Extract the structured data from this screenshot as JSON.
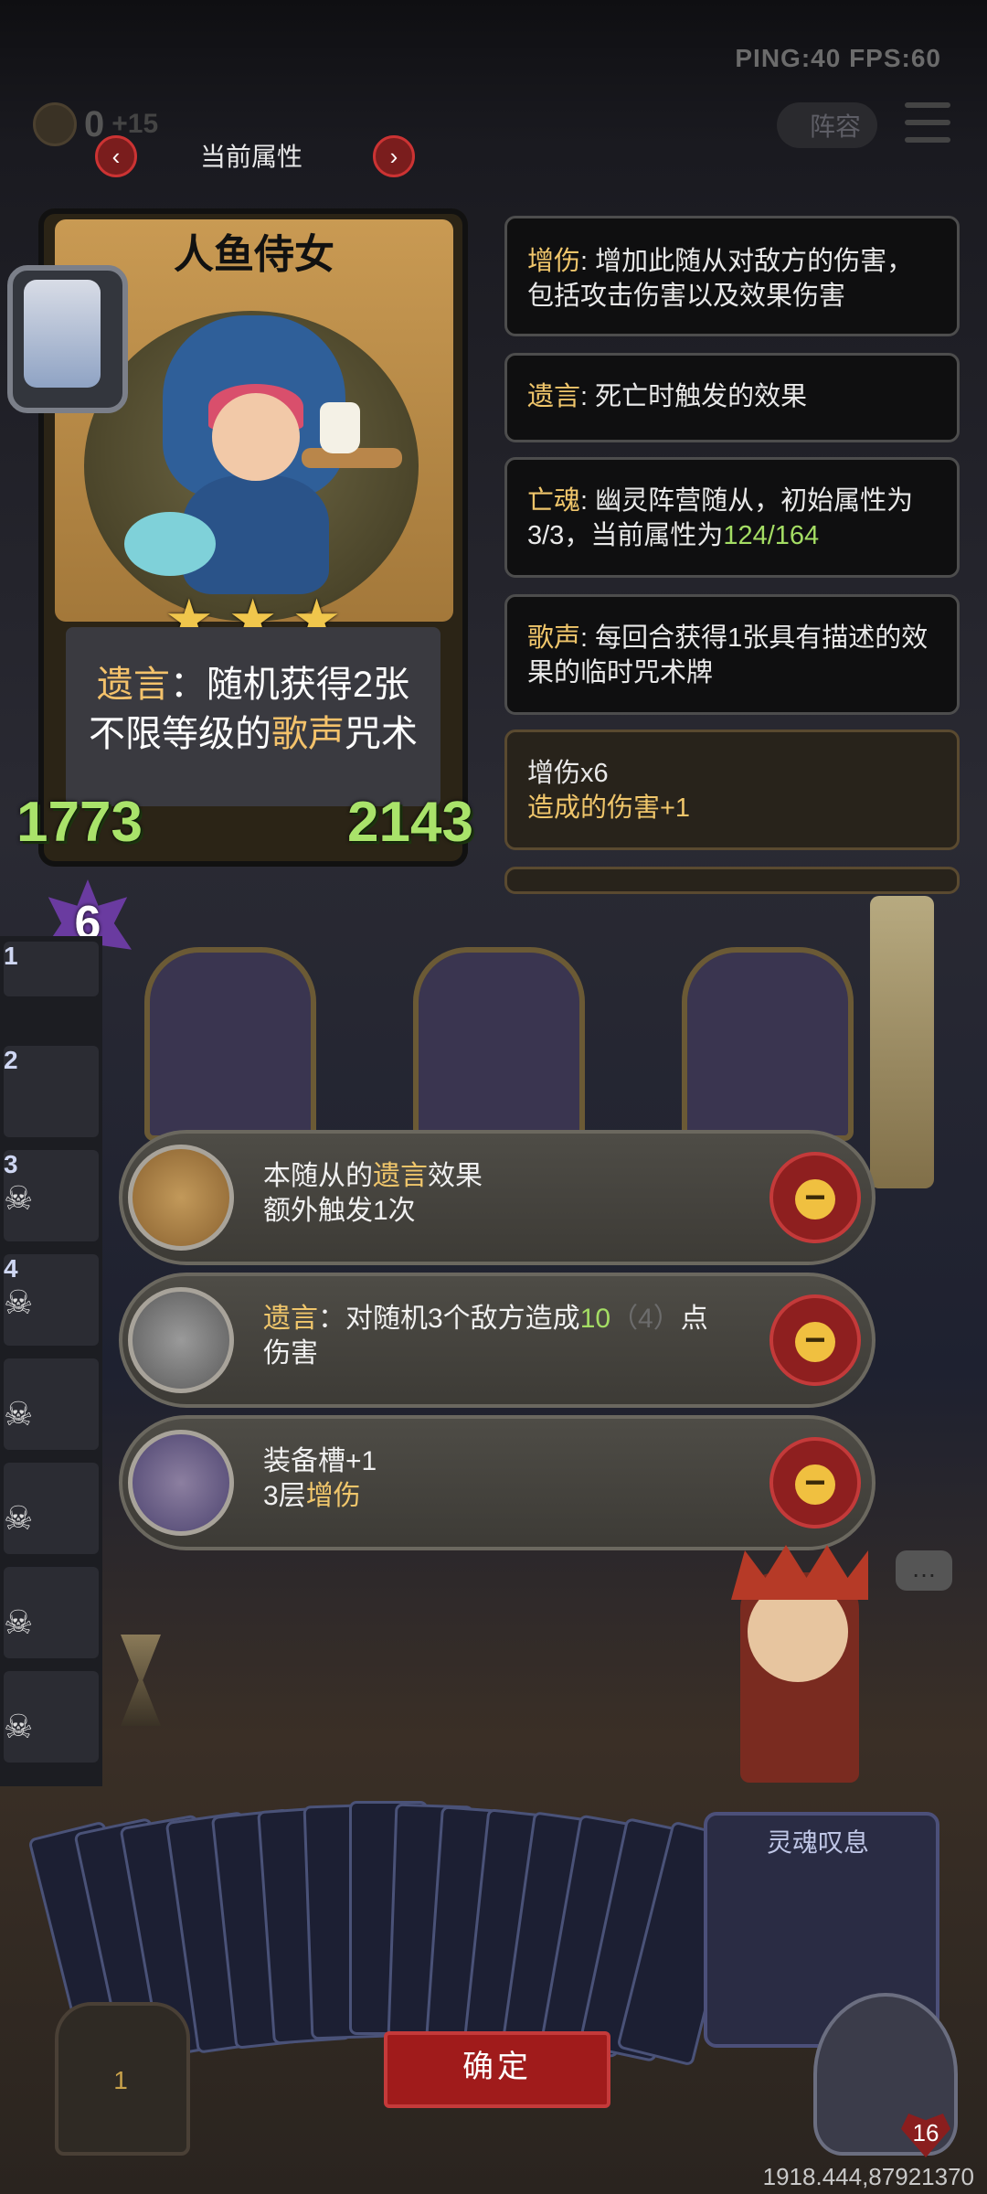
{
  "status": {
    "ping_fps": "PING:40  FPS:60"
  },
  "topbar": {
    "coins": "0",
    "coins_plus": "+15",
    "lineup_label": "阵容"
  },
  "header": {
    "title": "当前属性",
    "prev": "‹",
    "next": "›"
  },
  "card": {
    "name": "人鱼侍女",
    "stars": [
      "★",
      "★",
      "★"
    ],
    "desc_prefix": "遗言",
    "desc_mid": "：随机获得2张",
    "desc_line2_a": "不限等级的",
    "desc_keyword": "歌声",
    "desc_line2_b": "咒术",
    "attack": "1773",
    "health": "2143"
  },
  "info_panels": [
    {
      "keyword": "增伤",
      "text": ": 增加此随从对敌方的伤害，包括攻击伤害以及效果伤害"
    },
    {
      "keyword": "遗言",
      "text": ": 死亡时触发的效果"
    },
    {
      "keyword": "亡魂",
      "text": ": 幽灵阵营随从，初始属性为3/3，当前属性为",
      "highlight": "124/164"
    },
    {
      "keyword": "歌声",
      "text": ": 每回合获得1张具有描述的效果的临时咒术牌"
    },
    {
      "line1": "增伤x6",
      "line2": "造成的伤害+1"
    }
  ],
  "mana": "6",
  "tiers": [
    "1",
    "2",
    "3",
    "4"
  ],
  "effects": [
    {
      "a": "本随从的",
      "kw": "遗言",
      "b": "效果",
      "line2": "额外触发1次"
    },
    {
      "kw": "遗言",
      "a": "：对随机3个敌方造成",
      "num": "10",
      "dim": "（4）",
      "b": "点",
      "line2": "伤害"
    },
    {
      "line1": "装备槽+1",
      "a": "3层",
      "kw": "增伤"
    }
  ],
  "confirm_label": "确定",
  "hand": {
    "featured_card": "灵魂叹息"
  },
  "hero": {
    "hp": "16",
    "chest": "1"
  },
  "coordinates": "1918.444,87921370"
}
